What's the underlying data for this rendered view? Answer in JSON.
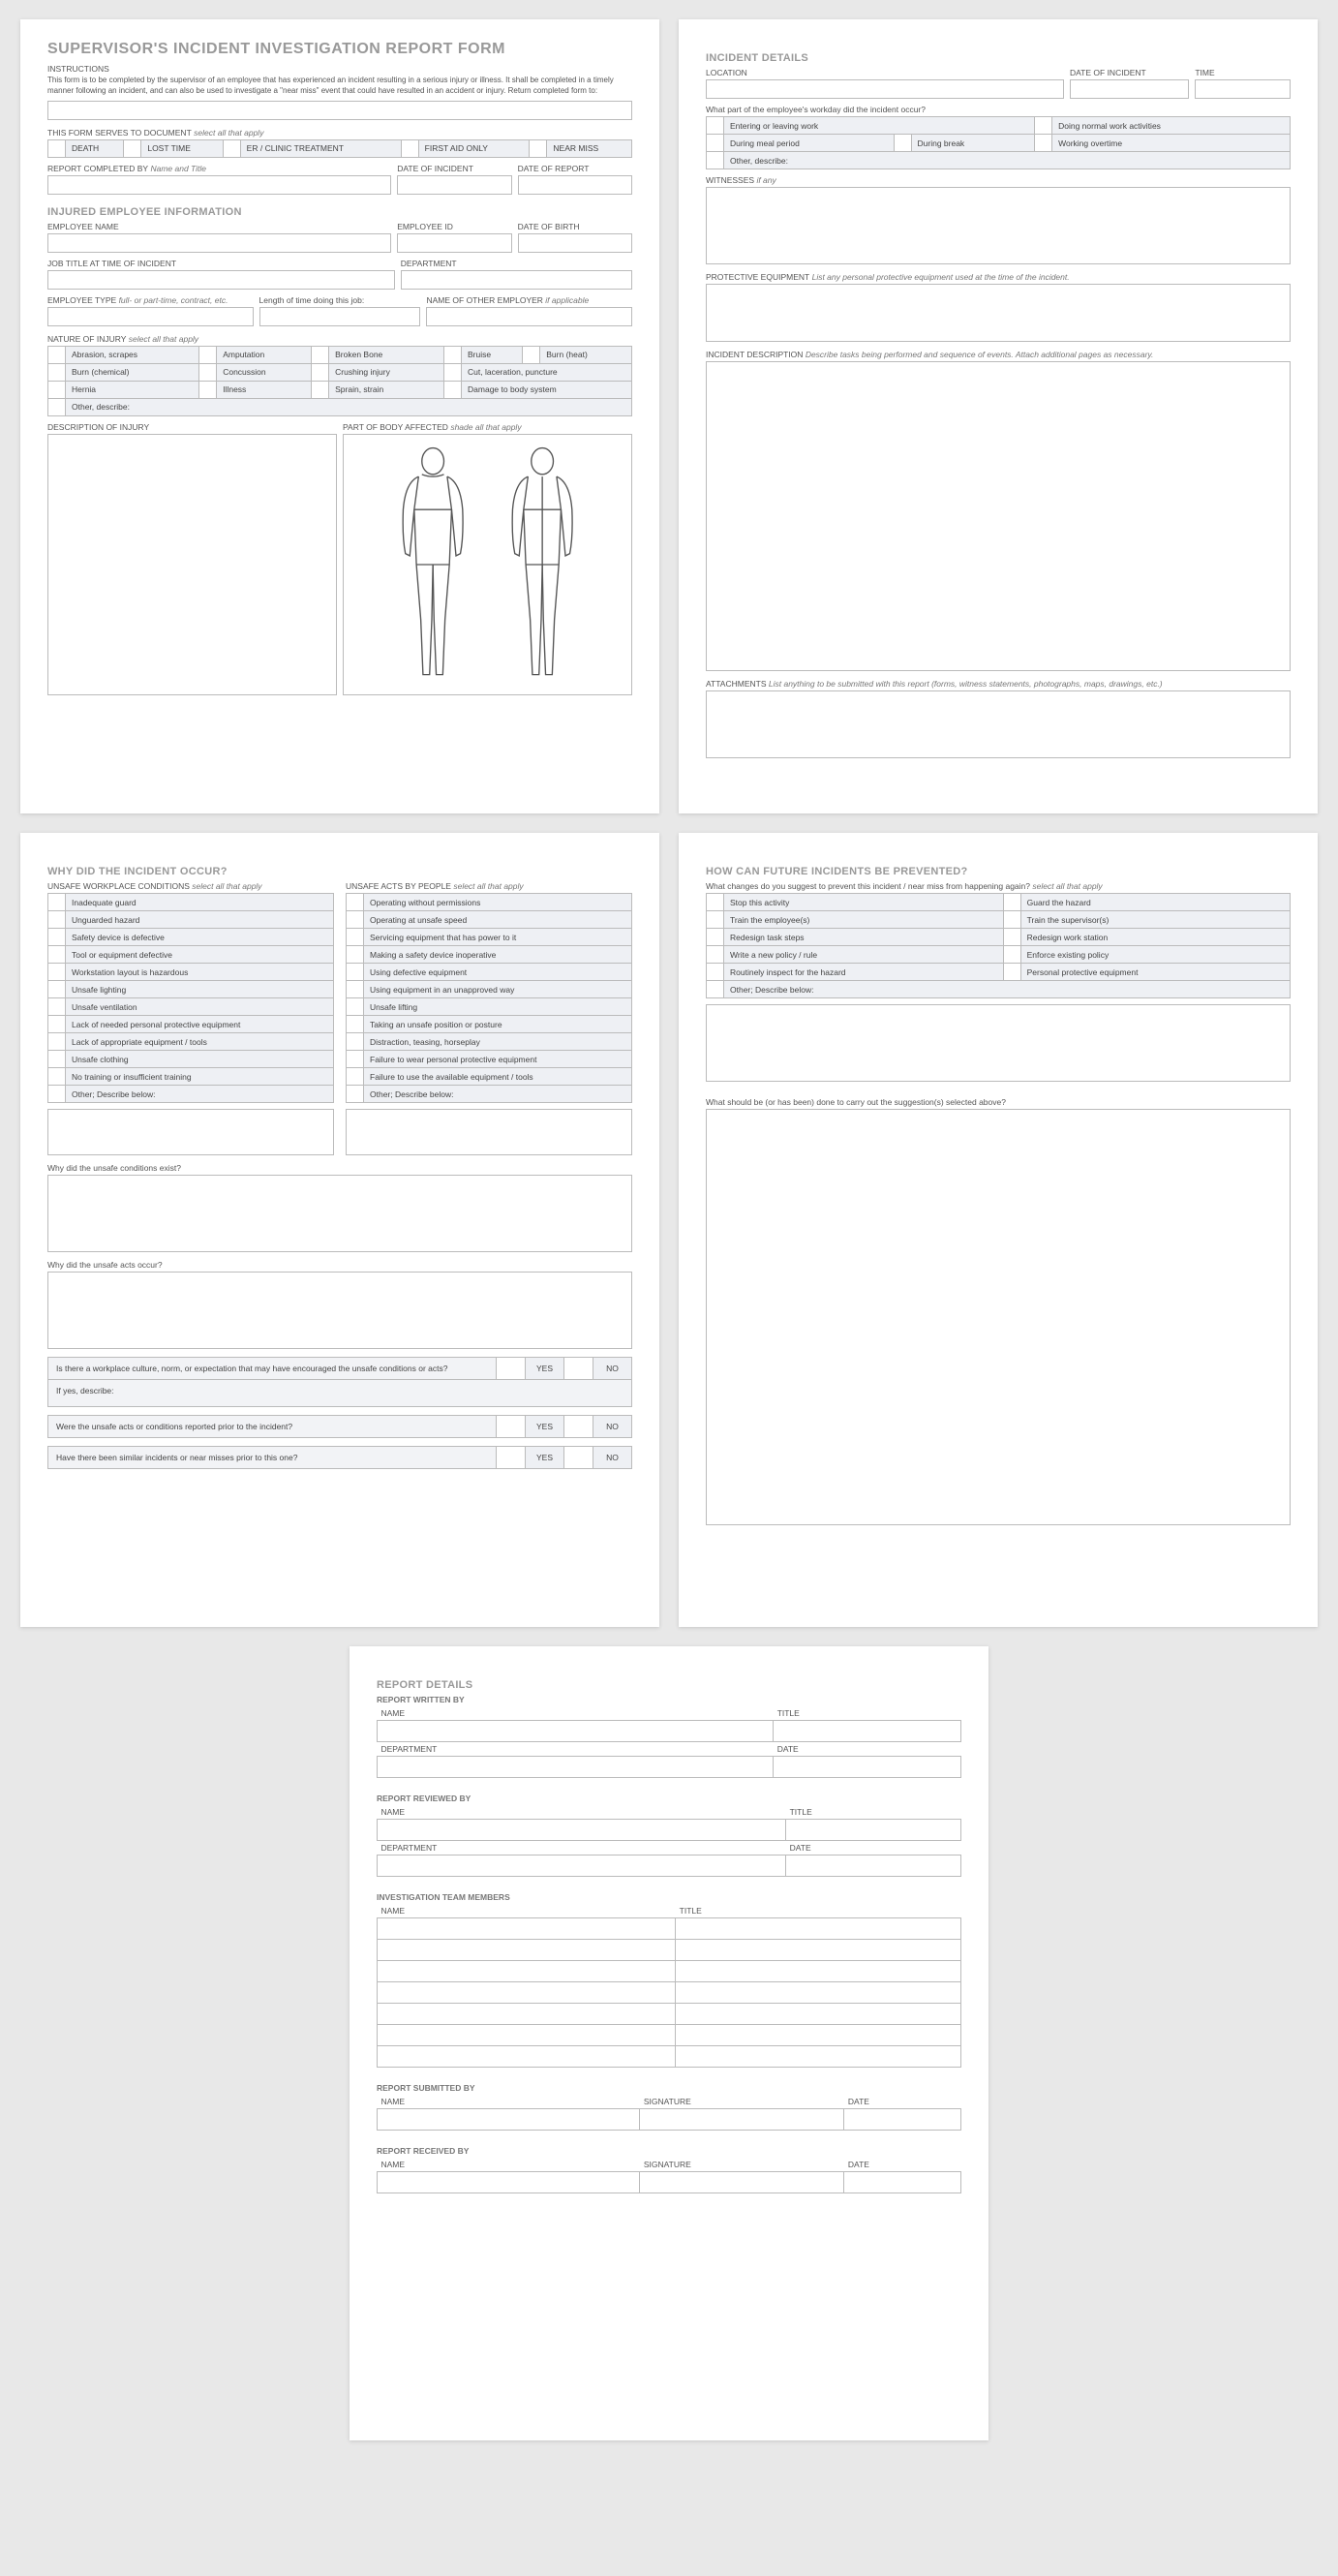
{
  "p1": {
    "title": "SUPERVISOR'S INCIDENT INVESTIGATION REPORT FORM",
    "instr_h": "INSTRUCTIONS",
    "instr": "This form is to be completed by the supervisor of an employee that has experienced an incident resulting in a serious injury or illness. It shall be completed in a timely manner following an incident, and can also be used to investigate a \"near miss\" event that could have resulted in an accident or injury. Return completed form to:",
    "doc_h": "THIS FORM SERVES TO DOCUMENT",
    "doc_hint": "select all that apply",
    "doc_opts": [
      "DEATH",
      "LOST TIME",
      "ER / CLINIC TREATMENT",
      "FIRST AID ONLY",
      "NEAR MISS"
    ],
    "rep_by": "REPORT COMPLETED BY",
    "rep_by_hint": "Name and Title",
    "doi": "DATE OF INCIDENT",
    "dor": "DATE OF REPORT",
    "emp_h": "INJURED EMPLOYEE INFORMATION",
    "emp_name": "EMPLOYEE NAME",
    "emp_id": "EMPLOYEE ID",
    "dob": "DATE OF BIRTH",
    "job": "JOB TITLE AT TIME OF INCIDENT",
    "dept": "DEPARTMENT",
    "etype": "EMPLOYEE TYPE",
    "etype_hint": "full- or part-time, contract, etc.",
    "len": "Length of time doing this job:",
    "other_emp": "NAME OF OTHER EMPLOYER",
    "other_emp_hint": "if applicable",
    "nat_h": "NATURE OF INJURY",
    "nat_hint": "select all that apply",
    "nat_rows": [
      [
        "Abrasion, scrapes",
        "Amputation",
        "Broken Bone",
        "Bruise",
        "Burn (heat)"
      ],
      [
        "Burn (chemical)",
        "Concussion",
        "Crushing injury",
        "Cut, laceration, puncture",
        ""
      ],
      [
        "Hernia",
        "Illness",
        "Sprain, strain",
        "Damage to body system",
        ""
      ]
    ],
    "nat_other": "Other, describe:",
    "desc_inj": "DESCRIPTION OF INJURY",
    "body": "PART OF BODY AFFECTED",
    "body_hint": "shade all that apply"
  },
  "p2": {
    "h": "INCIDENT DETAILS",
    "loc": "LOCATION",
    "doi": "DATE OF INCIDENT",
    "time": "TIME",
    "wd": "What part of the employee's workday did the incident occur?",
    "wd_rows": [
      [
        "Entering or leaving work",
        "Doing normal work activities"
      ],
      [
        "During meal period",
        "During break",
        "Working overtime"
      ]
    ],
    "wd_other": "Other, describe:",
    "wit": "WITNESSES",
    "wit_hint": "if any",
    "ppe": "PROTECTIVE EQUIPMENT",
    "ppe_hint": "List any personal protective equipment used at the time of the incident.",
    "idesc": "INCIDENT DESCRIPTION",
    "idesc_hint": "Describe tasks being performed and sequence of events.  Attach additional pages as necessary.",
    "att": "ATTACHMENTS",
    "att_hint": "List anything to be submitted with this report (forms, witness statements, photographs, maps, drawings, etc.)"
  },
  "p3": {
    "h": "WHY DID THE INCIDENT OCCUR?",
    "cond_h": "UNSAFE WORKPLACE CONDITIONS",
    "hint": "select all that apply",
    "acts_h": "UNSAFE ACTS BY PEOPLE",
    "cond": [
      "Inadequate guard",
      "Unguarded hazard",
      "Safety device is defective",
      "Tool or equipment defective",
      "Workstation layout is hazardous",
      "Unsafe lighting",
      "Unsafe ventilation",
      "Lack of needed personal protective equipment",
      "Lack of appropriate equipment / tools",
      "Unsafe clothing",
      "No training or insufficient training",
      "Other; Describe below:"
    ],
    "acts": [
      "Operating without permissions",
      "Operating at unsafe speed",
      "Servicing equipment that has power to it",
      "Making a safety device inoperative",
      "Using defective equipment",
      "Using equipment in an unapproved way",
      "Unsafe lifting",
      "Taking an unsafe position or posture",
      "Distraction, teasing, horseplay",
      "Failure to wear personal protective equipment",
      "Failure to use the available equipment / tools",
      "Other; Describe below:"
    ],
    "q1": "Why did the unsafe conditions exist?",
    "q2": "Why did the unsafe acts occur?",
    "q3": "Is there a workplace culture, norm, or expectation that may have encouraged the unsafe conditions or acts?",
    "ifyes": "If yes, describe:",
    "q4": "Were the unsafe acts or conditions reported prior to the incident?",
    "q5": "Have there been similar incidents or near misses prior to this one?",
    "yes": "YES",
    "no": "NO"
  },
  "p4": {
    "h": "HOW CAN FUTURE INCIDENTS BE PREVENTED?",
    "sub": "What changes do you suggest to prevent this incident / near miss from happening again?",
    "hint": "select all that apply",
    "rows": [
      [
        "Stop this activity",
        "Guard the hazard"
      ],
      [
        "Train the employee(s)",
        "Train the supervisor(s)"
      ],
      [
        "Redesign task steps",
        "Redesign work station"
      ],
      [
        "Write a new policy / rule",
        "Enforce existing policy"
      ],
      [
        "Routinely inspect for the hazard",
        "Personal protective equipment"
      ]
    ],
    "other": "Other; Describe below:",
    "q": "What should be (or has been) done to carry out the suggestion(s) selected above?"
  },
  "p5": {
    "h": "REPORT DETAILS",
    "wr": "REPORT WRITTEN BY",
    "rv": "REPORT REVIEWED BY",
    "team": "INVESTIGATION TEAM MEMBERS",
    "sub": "REPORT SUBMITTED BY",
    "rec": "REPORT RECEIVED BY",
    "name": "NAME",
    "title": "TITLE",
    "dept": "DEPARTMENT",
    "date": "DATE",
    "sig": "SIGNATURE"
  }
}
